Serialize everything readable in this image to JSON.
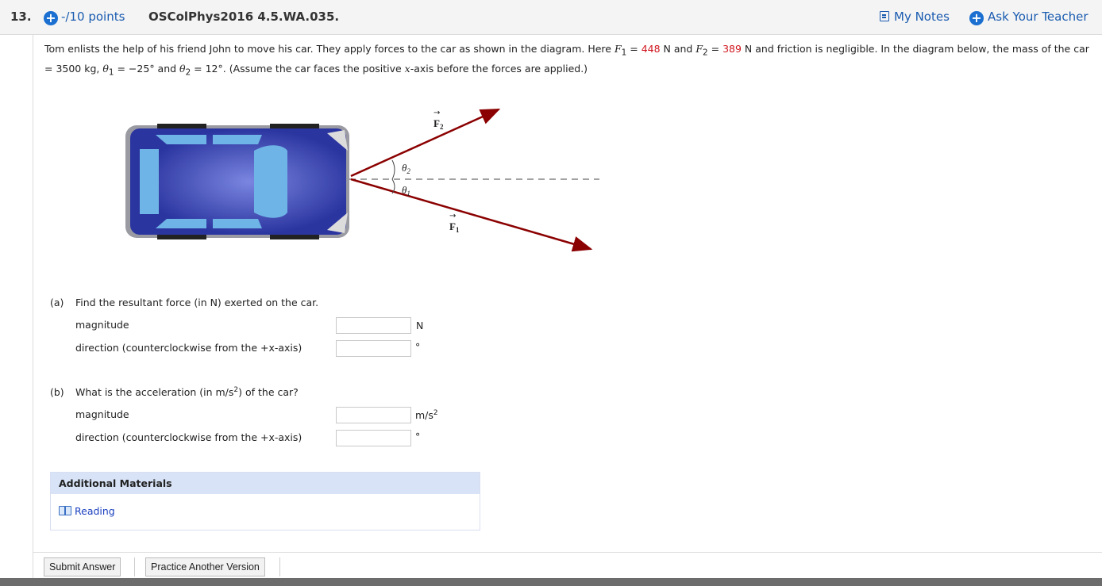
{
  "header": {
    "question_number": "13.",
    "points": "-/10 points",
    "question_id": "OSColPhys2016 4.5.WA.035.",
    "my_notes": "My Notes",
    "ask_teacher": "Ask Your Teacher"
  },
  "problem": {
    "text_1": "Tom enlists the help of his friend John to move his car. They apply forces to the car as shown in the diagram. Here ",
    "f1_label": "F",
    "f1_sub": "1",
    "eq1": " = ",
    "f1_value": "448",
    "text_2": " N and ",
    "f2_label": "F",
    "f2_sub": "2",
    "eq2": " = ",
    "f2_value": "389",
    "text_3": " N and friction is negligible. In the diagram below, the mass of the car = 3500 kg, ",
    "theta1_label": "θ",
    "theta1_sub": "1",
    "theta1_val": " = −25° and ",
    "theta2_label": "θ",
    "theta2_sub": "2",
    "theta2_val": " = 12°. (Assume the car faces the positive ",
    "x_axis": "x",
    "text_4": "-axis before the forces are applied.)"
  },
  "diagram": {
    "f2_label": "F",
    "f2_sub": "2",
    "f1_label": "F",
    "f1_sub": "1",
    "theta2_label": "θ",
    "theta2_sub": "2",
    "theta1_label": "θ",
    "theta1_sub": "1",
    "arrow_color": "#8b0000",
    "car_color": "#2e3aa6"
  },
  "part_a": {
    "label": "(a)",
    "question": "Find the resultant force (in N) exerted on the car.",
    "magnitude_label": "magnitude",
    "magnitude_unit": "N",
    "direction_label": "direction (counterclockwise from the +x-axis)",
    "direction_unit": "°"
  },
  "part_b": {
    "label": "(b)",
    "question_1": "What is the acceleration (in m/s",
    "question_sup": "2",
    "question_2": ") of the car?",
    "magnitude_label": "magnitude",
    "magnitude_unit": "m/s",
    "magnitude_unit_sup": "2",
    "direction_label": "direction (counterclockwise from the +x-axis)",
    "direction_unit": "°"
  },
  "additional": {
    "title": "Additional Materials",
    "reading": "Reading"
  },
  "buttons": {
    "submit": "Submit Answer",
    "practice": "Practice Another Version"
  }
}
